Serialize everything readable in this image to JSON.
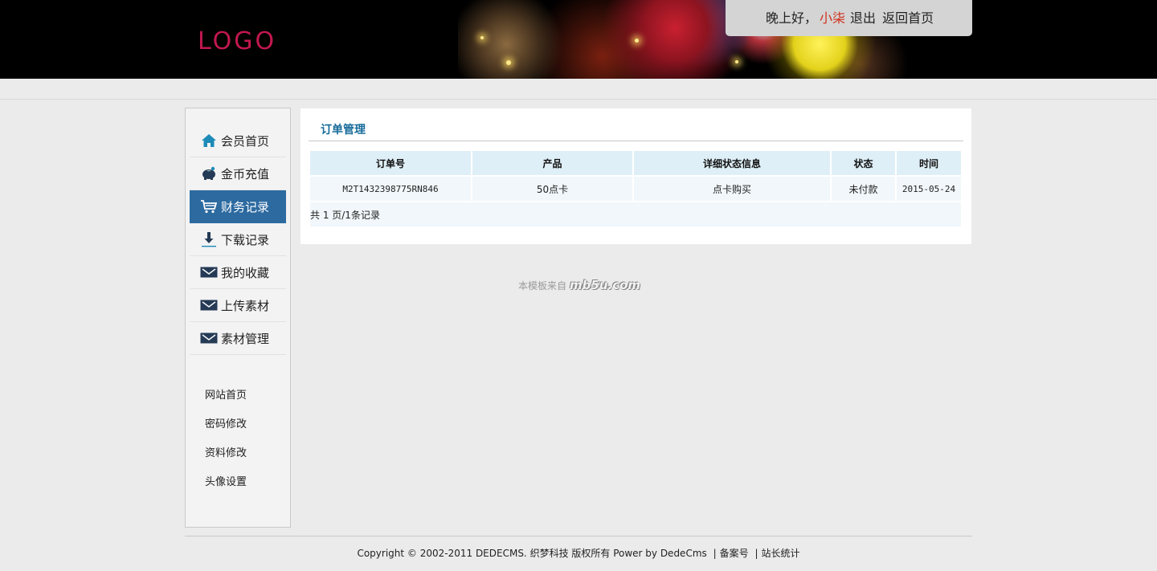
{
  "header": {
    "logo": "LOGO",
    "greeting": "晚上好，",
    "username": "小柒",
    "logout": "退出",
    "home": "返回首页"
  },
  "sidebar": {
    "nav": [
      {
        "label": "会员首页",
        "icon": "home-icon"
      },
      {
        "label": "金币充值",
        "icon": "piggy-bank-icon"
      },
      {
        "label": "财务记录",
        "icon": "cart-icon"
      },
      {
        "label": "下载记录",
        "icon": "download-icon"
      },
      {
        "label": "我的收藏",
        "icon": "envelope-icon"
      },
      {
        "label": "上传素材",
        "icon": "envelope-icon"
      },
      {
        "label": "素材管理",
        "icon": "envelope-icon"
      }
    ],
    "links": [
      "网站首页",
      "密码修改",
      "资料修改",
      "头像设置"
    ]
  },
  "main": {
    "title": "订单管理",
    "columns": [
      "订单号",
      "产品",
      "详细状态信息",
      "状态",
      "时间"
    ],
    "rows": [
      [
        "M2T1432398775RN846",
        "50点卡",
        "点卡购买",
        "未付款",
        "2015-05-24"
      ]
    ],
    "pager": "共 1 页/1条记录"
  },
  "watermark": {
    "text": "本模板来自",
    "site": "mb5u.com"
  },
  "footer": {
    "copyright": "Copyright © 2002-2011 DEDECMS. 织梦科技 版权所有 Power by DedeCms",
    "sep": "|",
    "beian": "备案号",
    "stats": "站长统计"
  },
  "colors": {
    "accent": "#2c6aa0",
    "title": "#176b9a",
    "username": "#d0301c",
    "logo": "#c2184f"
  }
}
